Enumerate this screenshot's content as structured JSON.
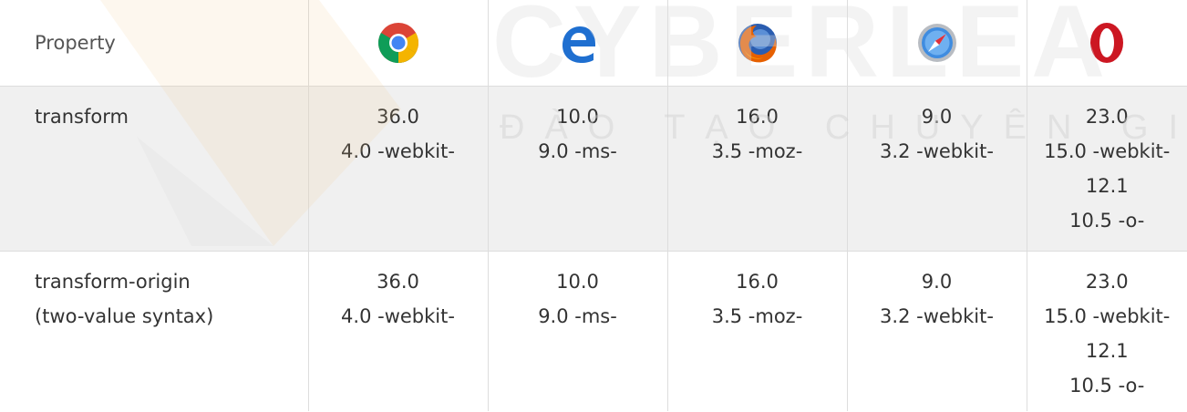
{
  "table": {
    "header": {
      "property_label": "Property",
      "browsers": [
        {
          "icon": "chrome-icon"
        },
        {
          "icon": "edge-icon"
        },
        {
          "icon": "firefox-icon"
        },
        {
          "icon": "safari-icon"
        },
        {
          "icon": "opera-icon"
        }
      ]
    },
    "rows": [
      {
        "property": [
          "transform"
        ],
        "values": [
          [
            "36.0",
            "4.0 -webkit-"
          ],
          [
            "10.0",
            "9.0 -ms-"
          ],
          [
            "16.0",
            "3.5 -moz-"
          ],
          [
            "9.0",
            "3.2 -webkit-"
          ],
          [
            "23.0",
            "15.0 -webkit-",
            "12.1",
            "10.5 -o-"
          ]
        ]
      },
      {
        "property": [
          "transform-origin",
          "(two-value syntax)"
        ],
        "values": [
          [
            "36.0",
            "4.0 -webkit-"
          ],
          [
            "10.0",
            "9.0 -ms-"
          ],
          [
            "16.0",
            "3.5 -moz-"
          ],
          [
            "9.0",
            "3.2 -webkit-"
          ],
          [
            "23.0",
            "15.0 -webkit-",
            "12.1",
            "10.5 -o-"
          ]
        ]
      }
    ]
  },
  "watermark": {
    "brand": "CYBERLEA",
    "tagline": "ĐÀO TẠO CHUYÊN GIA LẬP"
  },
  "colors": {
    "header_bg": "#ffffff",
    "shaded_row_bg": "#f0f0f0",
    "border": "#dddddd",
    "text": "#333333",
    "edge_blue": "#1f6fd0",
    "opera_red": "#cc1722",
    "watermark": "#e6e6e6"
  }
}
